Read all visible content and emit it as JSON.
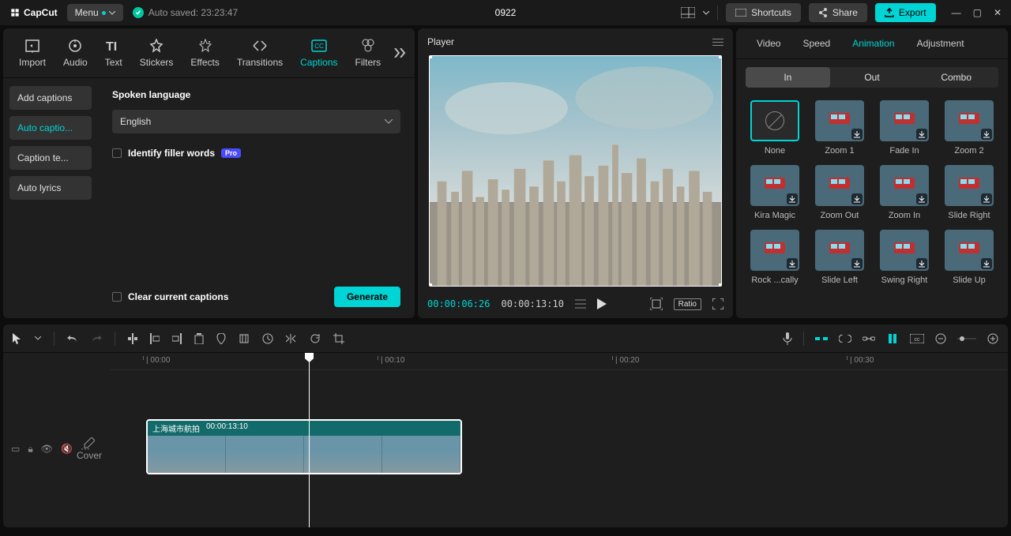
{
  "app": {
    "name": "CapCut",
    "menu_label": "Menu",
    "autosave": "Auto saved: 23:23:47",
    "project": "0922"
  },
  "top_buttons": {
    "shortcuts": "Shortcuts",
    "share": "Share",
    "export": "Export"
  },
  "media_tabs": [
    {
      "label": "Import"
    },
    {
      "label": "Audio"
    },
    {
      "label": "Text"
    },
    {
      "label": "Stickers"
    },
    {
      "label": "Effects"
    },
    {
      "label": "Transitions"
    },
    {
      "label": "Captions",
      "active": true
    },
    {
      "label": "Filters"
    }
  ],
  "captions": {
    "sidebar": [
      {
        "label": "Add captions"
      },
      {
        "label": "Auto captio...",
        "active": true
      },
      {
        "label": "Caption te..."
      },
      {
        "label": "Auto lyrics"
      }
    ],
    "spoken_label": "Spoken language",
    "language": "English",
    "filler_label": "Identify filler words",
    "pro_badge": "Pro",
    "clear_label": "Clear current captions",
    "generate_label": "Generate"
  },
  "player": {
    "title": "Player",
    "current": "00:00:06:26",
    "total": "00:00:13:10",
    "ratio": "Ratio"
  },
  "properties": {
    "tabs": [
      "Video",
      "Speed",
      "Animation",
      "Adjustment"
    ],
    "active_tab": "Animation",
    "anim_tabs": [
      "In",
      "Out",
      "Combo"
    ],
    "active_anim_tab": "In",
    "presets": [
      {
        "label": "None",
        "selected": true,
        "none": true
      },
      {
        "label": "Zoom 1"
      },
      {
        "label": "Fade In"
      },
      {
        "label": "Zoom 2"
      },
      {
        "label": "Kira Magic"
      },
      {
        "label": "Zoom Out"
      },
      {
        "label": "Zoom In"
      },
      {
        "label": "Slide Right"
      },
      {
        "label": "Rock ...cally"
      },
      {
        "label": "Slide Left"
      },
      {
        "label": "Swing Right"
      },
      {
        "label": "Slide Up"
      }
    ]
  },
  "timeline": {
    "ruler": [
      "00:00",
      "00:10",
      "00:20",
      "00:30"
    ],
    "cover_label": "Cover",
    "clip": {
      "name": "上海城市航拍",
      "duration": "00:00:13:10"
    }
  }
}
